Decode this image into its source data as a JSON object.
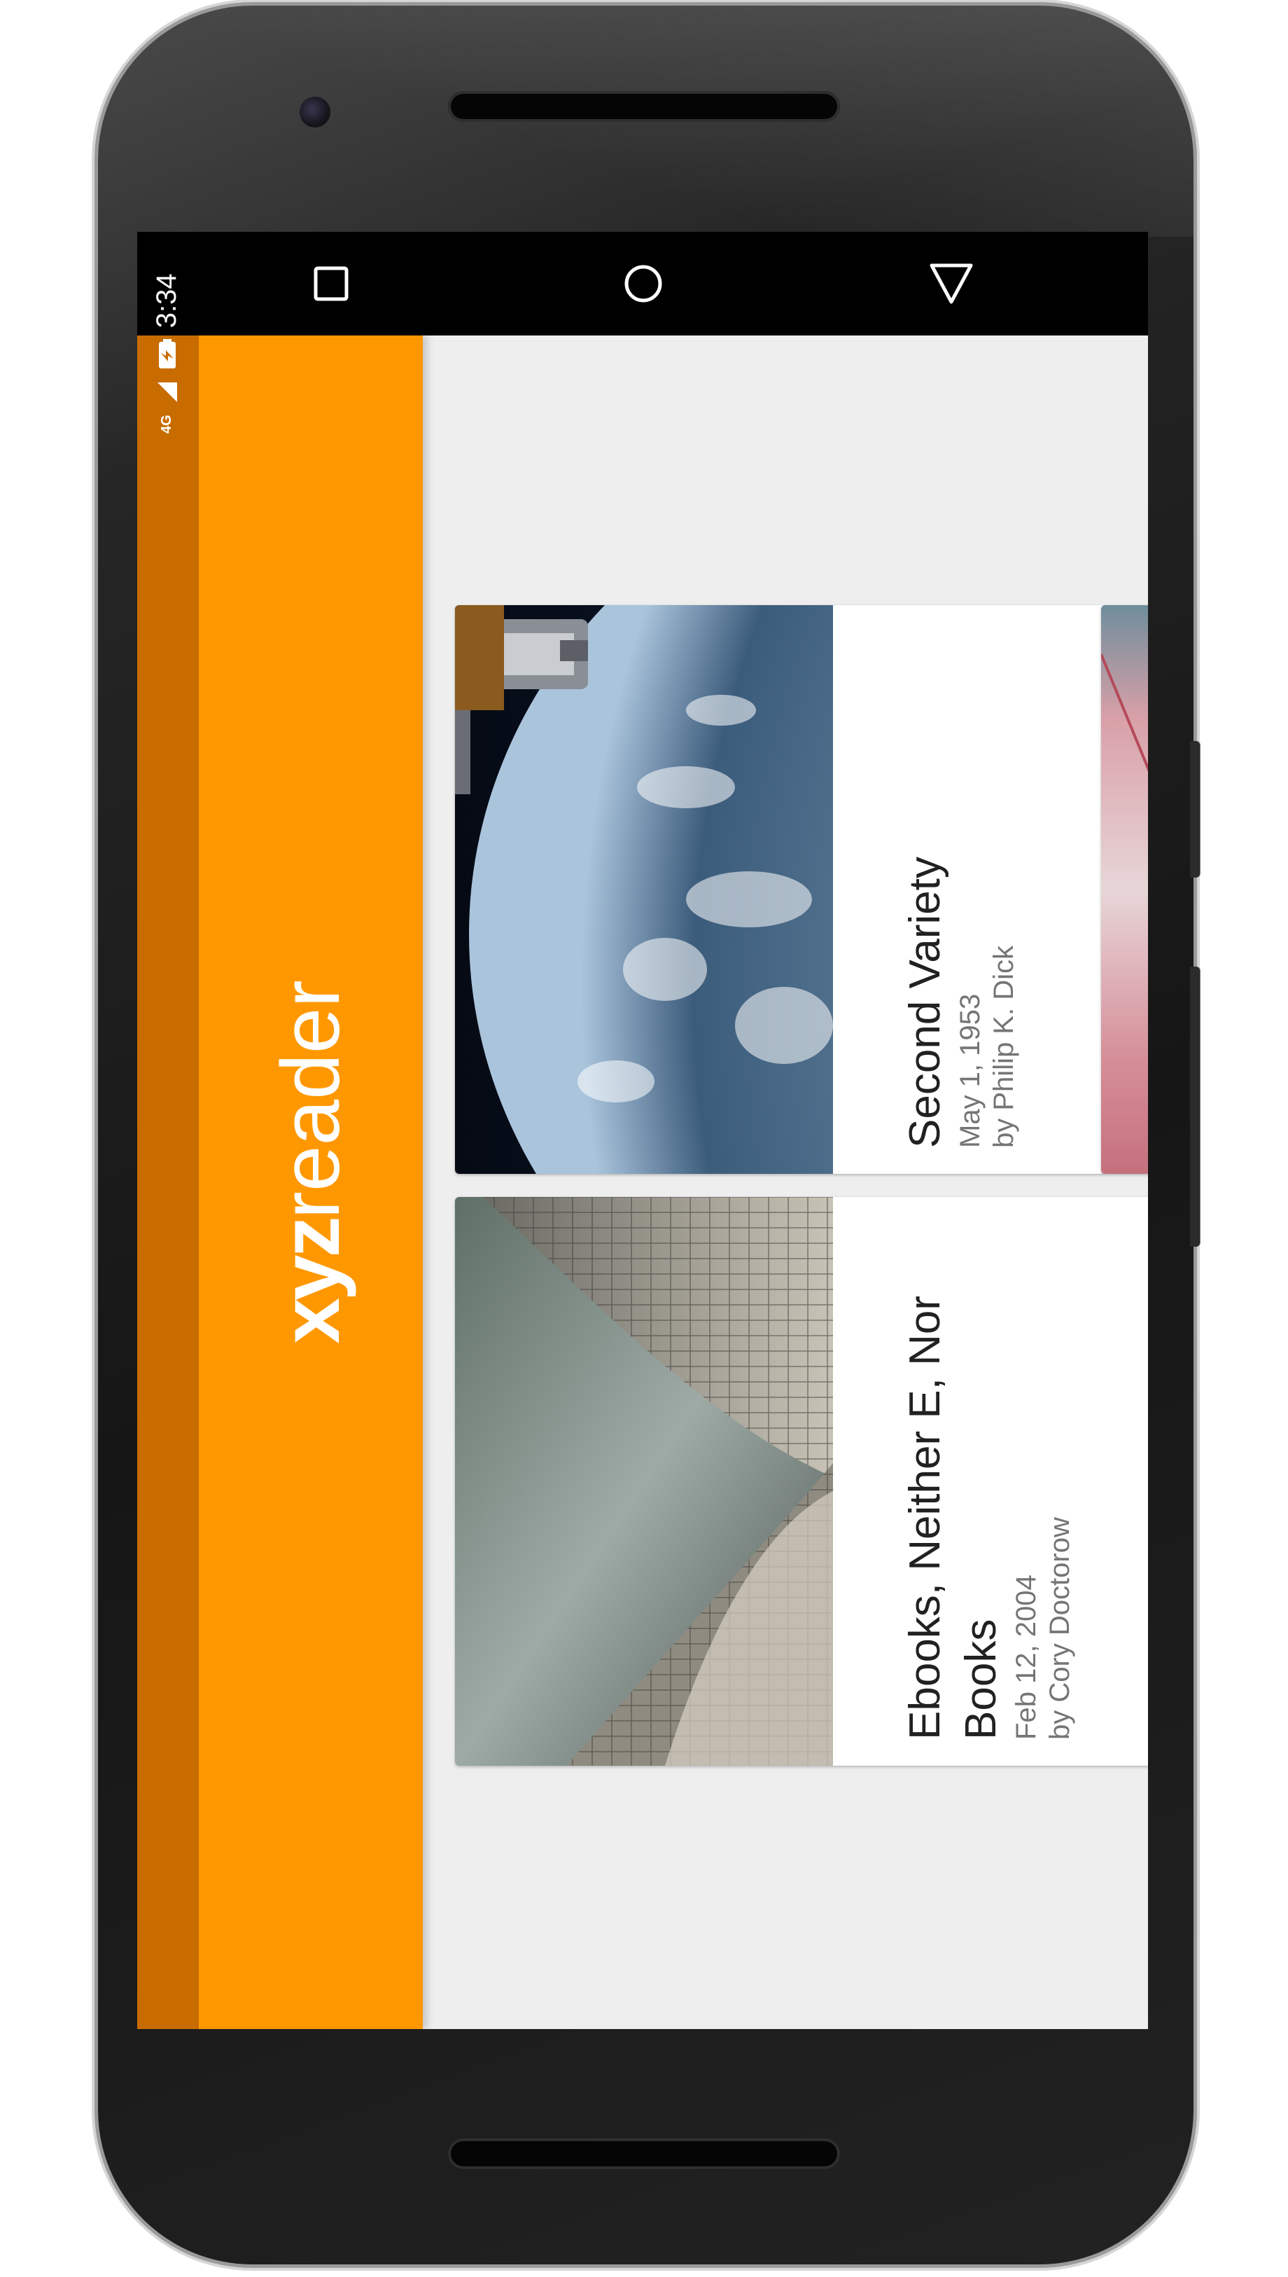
{
  "navigation": {
    "recent_icon": "square-icon",
    "home_icon": "circle-icon",
    "back_icon": "triangle-icon"
  },
  "status_bar": {
    "time": "3:34",
    "network": "4G",
    "battery_icon": "battery-charging-icon",
    "signal_icon": "signal-icon"
  },
  "app": {
    "logo_bold": "xyz",
    "logo_light": "reader",
    "toolbar_color": "#ff9800",
    "statusbar_color": "#c96c00"
  },
  "articles": [
    {
      "title": "Second Variety",
      "date": "May 1, 1953",
      "author": "by Philip K. Dick",
      "image": "earth-from-space-image"
    },
    {
      "title_line1": "Ebooks, Neither E, Nor",
      "title_line2": "Books",
      "date": "Feb 12, 2004",
      "author": "by Cory Doctorow",
      "image": "opera-house-roof-image"
    }
  ]
}
